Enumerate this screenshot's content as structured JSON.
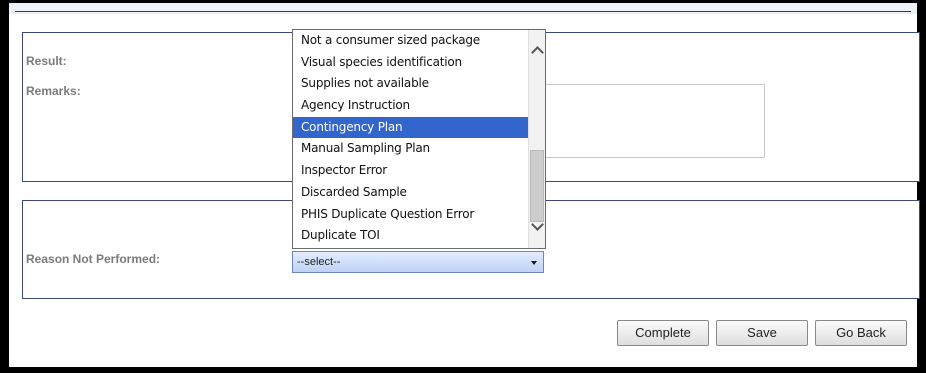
{
  "form": {
    "result_label": "Result:",
    "remarks_label": "Remarks:",
    "reason_label": "Reason Not Performed:",
    "reason_select": {
      "selected_value": "--select--",
      "options": [
        "Not a consumer sized package",
        "Visual species identification",
        "Supplies not available",
        "Agency Instruction",
        "Contingency Plan",
        "Manual Sampling Plan",
        "Inspector Error",
        "Discarded Sample",
        "PHIS Duplicate Question Error",
        "Duplicate TOI"
      ],
      "highlighted_option": "Contingency Plan"
    }
  },
  "actions": {
    "complete_label": "Complete",
    "save_label": "Save",
    "go_back_label": "Go Back"
  },
  "colors": {
    "highlight": "#3266cc",
    "panel_border": "#3b4a7a",
    "label_text": "#7b7b7b"
  },
  "icons": {
    "scroll_up": "chevron-up-icon",
    "scroll_down": "chevron-down-icon",
    "select_arrow": "triangle-down-icon"
  }
}
